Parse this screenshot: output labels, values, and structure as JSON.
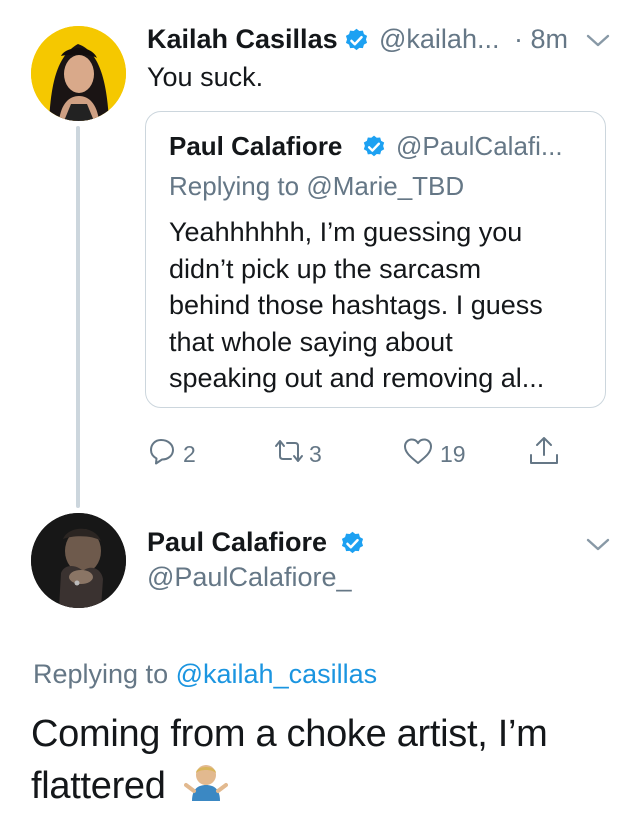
{
  "first_tweet": {
    "author_name": "Kailah Casillas",
    "author_handle": "@kailah...",
    "time": "· 8m",
    "text": "You suck.",
    "avatar_icon": "user-avatar-photo",
    "quoted": {
      "author_name": "Paul Calafiore",
      "author_handle": "@PaulCalafi...",
      "replying_prefix": "Replying to",
      "replying_handle": "@Marie_TBD",
      "text_lines": [
        "Yeahhhhhh, I’m guessing you",
        "didn’t pick up the sarcasm",
        "behind those hashtags. I guess",
        "that whole saying about",
        "speaking out and removing al..."
      ]
    },
    "actions": {
      "reply_count": "2",
      "retweet_count": "3",
      "like_count": "19"
    }
  },
  "second_tweet": {
    "author_name": "Paul Calafiore",
    "author_handle": "@PaulCalafiore_",
    "replying_prefix": "Replying to",
    "replying_handle": "@kailah_casillas",
    "text_line1": "Coming from a choke artist, I’m",
    "text_line2": "flattered",
    "emoji": "🤷🏼‍♂️",
    "emoji_name": "man-shrugging-emoji"
  },
  "colors": {
    "verified": "#1da1f2",
    "link": "#1b95e0",
    "muted": "#657786",
    "divider": "#ccd6dd"
  }
}
